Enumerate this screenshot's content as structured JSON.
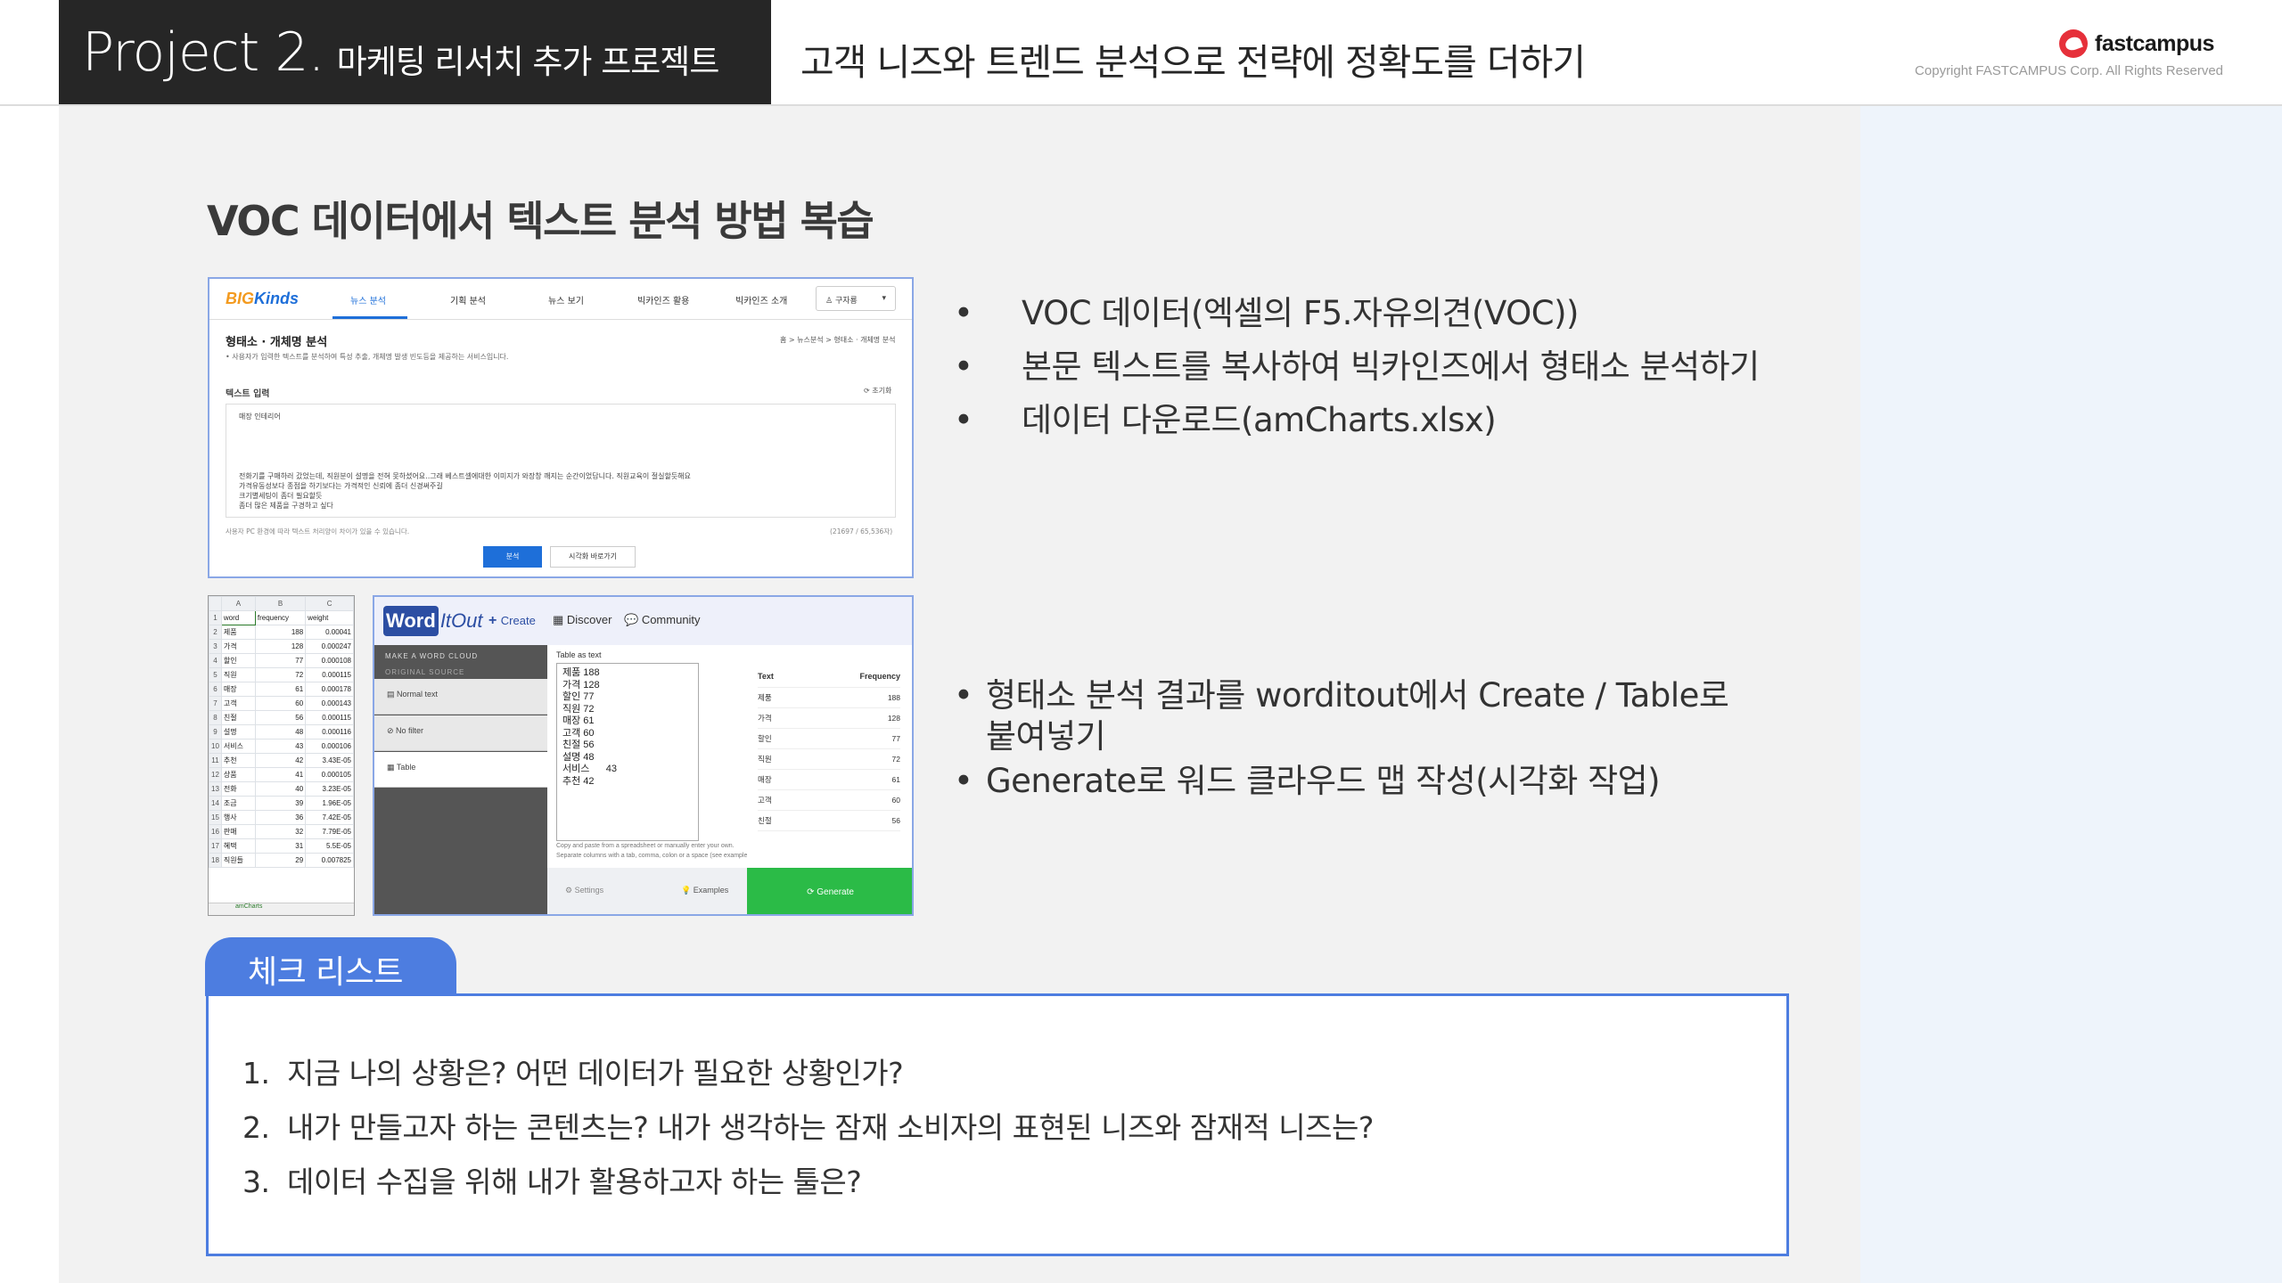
{
  "header": {
    "project": "Project 2.",
    "project_kor": "마케팅 리서치 추가 프로젝트",
    "subtitle": "고객 니즈와 트렌드 분석으로 전략에 정확도를 더하기",
    "brand": "fastcampus",
    "copyright": "Copyright FASTCAMPUS Corp. All Rights Reserved",
    "accent_color": "#e6303a",
    "logo_icon": "fastcampus-logo-icon"
  },
  "main": {
    "section_title": "VOC 데이터에서 텍스트 분석 방법 복습",
    "bullets_top": [
      "VOC 데이터(엑셀의  F5.자유의견(VOC))",
      "본문 텍스트를 복사하여 빅카인즈에서 형태소 분석하기",
      "데이터 다운로드(amCharts.xlsx)"
    ],
    "bullets_bottom": [
      "형태소 분석 결과를 worditout에서 Create / Table로\n붙여넣기",
      "Generate로 워드 클라우드 맵 작성(시각화 작업)"
    ],
    "bullet_char": "•"
  },
  "bigkinds": {
    "logo_a": "BIG",
    "logo_b": "Kinds",
    "menu": [
      "뉴스 분석",
      "기획 분석",
      "뉴스 보기",
      "빅카인즈 활용",
      "빅카인즈 소개"
    ],
    "user": "구자룡",
    "page_title": "형태소 · 개체명 분석",
    "page_desc": "• 사용자가 입력한 텍스트를 분석하여 특성 추출, 개체명 발생 빈도등을 제공하는 서비스입니다.",
    "breadcrumb": "홈   >   뉴스분석   >   형태소 · 개체명 분석",
    "input_label": "텍스트 입력",
    "reset": "초기화",
    "text_line1": "매장 인테리어",
    "text_line2": "전화기를 구매하러 갔었는데, 직원분이 설명을 전혀 못하셨어요..그래 베스트셀에대한 이미지가 와장창 깨지는 순간이었답니다. 직원교육이 절실할듯해요",
    "text_line3": "가격유동성보다 종점을 하기보다는 가격적인 신뢰에 좀더 신경써주길",
    "text_line4": "크기별세팅이 좀더 필요할듯",
    "text_line5": "좀더 많은 제품을 구경하고 싶다",
    "note": "사용자 PC 환경에 따라 텍스트 처리양이 차이가 있을 수 있습니다.",
    "count": "(21697 / 65,536자)",
    "btn_analyze": "분석",
    "btn_visual": "시각화 바로가기"
  },
  "excel": {
    "columns": [
      "A",
      "B",
      "C"
    ],
    "header": [
      "word",
      "frequency",
      "weight"
    ],
    "rows": [
      [
        "제품",
        "188",
        "0.00041"
      ],
      [
        "가격",
        "128",
        "0.000247"
      ],
      [
        "할인",
        "77",
        "0.000108"
      ],
      [
        "직원",
        "72",
        "0.000115"
      ],
      [
        "매장",
        "61",
        "0.000178"
      ],
      [
        "고객",
        "60",
        "0.000143"
      ],
      [
        "친절",
        "56",
        "0.000115"
      ],
      [
        "설명",
        "48",
        "0.000116"
      ],
      [
        "서비스",
        "43",
        "0.000106"
      ],
      [
        "추천",
        "42",
        "3.43E-05"
      ],
      [
        "상품",
        "41",
        "0.000105"
      ],
      [
        "전화",
        "40",
        "3.23E-05"
      ],
      [
        "조금",
        "39",
        "1.96E-05"
      ],
      [
        "행사",
        "36",
        "7.42E-05"
      ],
      [
        "판매",
        "32",
        "7.79E-05"
      ],
      [
        "혜택",
        "31",
        "5.5E-05"
      ],
      [
        "직원들",
        "29",
        "0.007825"
      ]
    ],
    "sheet_tab": "amCharts"
  },
  "worditout": {
    "logo_word": "Word",
    "logo_rest": "ItOut",
    "nav": [
      "Create",
      "Discover",
      "Community"
    ],
    "left_heading1": "MAKE A WORD CLOUD",
    "left_heading2": "ORIGINAL SOURCE",
    "options": [
      "Normal text",
      "No filter",
      "Table"
    ],
    "table_label": "Table as text",
    "table_text": "제품 188\n가격 128\n할인 77\n직원 72\n매장 61\n고객 60\n친절 56\n설명 48\n서비스      43\n추천 42",
    "hint1": "Copy and paste from a spreadsheet or manually enter your own.",
    "hint2": "Separate columns with a tab, comma, colon or a space (see examples).",
    "result_header": [
      "Text",
      "Frequency"
    ],
    "result_rows": [
      [
        "제품",
        "188"
      ],
      [
        "가격",
        "128"
      ],
      [
        "할인",
        "77"
      ],
      [
        "직원",
        "72"
      ],
      [
        "매장",
        "61"
      ],
      [
        "고객",
        "60"
      ],
      [
        "친절",
        "56"
      ]
    ],
    "settings": "Settings",
    "examples": "Examples",
    "generate": "Generate"
  },
  "checklist": {
    "tab_label": "체크 리스트",
    "items": [
      {
        "num": "1.",
        "text": "지금 나의 상황은? 어떤 데이터가 필요한 상황인가?"
      },
      {
        "num": "2.",
        "text": "내가 만들고자 하는 콘텐츠는? 내가 생각하는 잠재 소비자의 표현된 니즈와 잠재적 니즈는?"
      },
      {
        "num": "3.",
        "text": "데이터 수집을 위해 내가 활용하고자 하는 툴은?"
      }
    ],
    "accent_color": "#4d7de0"
  }
}
